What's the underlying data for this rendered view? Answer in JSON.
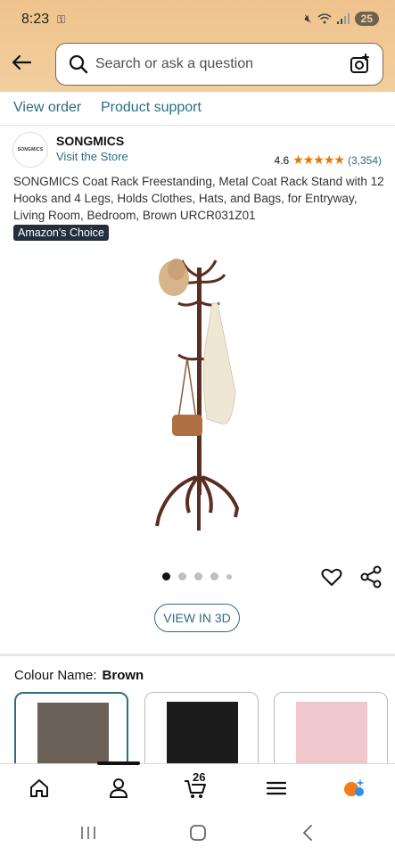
{
  "status_bar": {
    "time": "8:23",
    "battery": "25"
  },
  "header": {
    "search_placeholder": "Search or ask a question"
  },
  "order_links": {
    "view_order": "View order",
    "product_support": "Product support"
  },
  "brand": {
    "logo_text": "SONGMICS",
    "name": "SONGMICS",
    "store_link": "Visit the Store"
  },
  "rating": {
    "value": "4.6",
    "stars": "★★★★★",
    "count": "(3,354)",
    "star_fraction": 0.92
  },
  "product": {
    "title": "SONGMICS Coat Rack Freestanding, Metal Coat Rack Stand with 12 Hooks and 4 Legs, Holds Clothes, Hats, and Bags, for Entryway, Living Room, Bedroom, Brown URCR031Z01",
    "badge": "Amazon's Choice",
    "image_count": 5,
    "active_image": 1
  },
  "view_3d": "VIEW IN 3D",
  "colour": {
    "label": "Colour Name:",
    "selected": "Brown",
    "options": [
      {
        "color": "#6b6058"
      },
      {
        "color": "#1c1c1c"
      },
      {
        "color": "#f0c8cc"
      }
    ]
  },
  "bottom_nav": {
    "cart_count": "26"
  },
  "colors": {
    "accent_link": "#2b6e82",
    "header_bg": "#efc38d",
    "star": "#e77600",
    "badge_bg": "#232f3e"
  }
}
